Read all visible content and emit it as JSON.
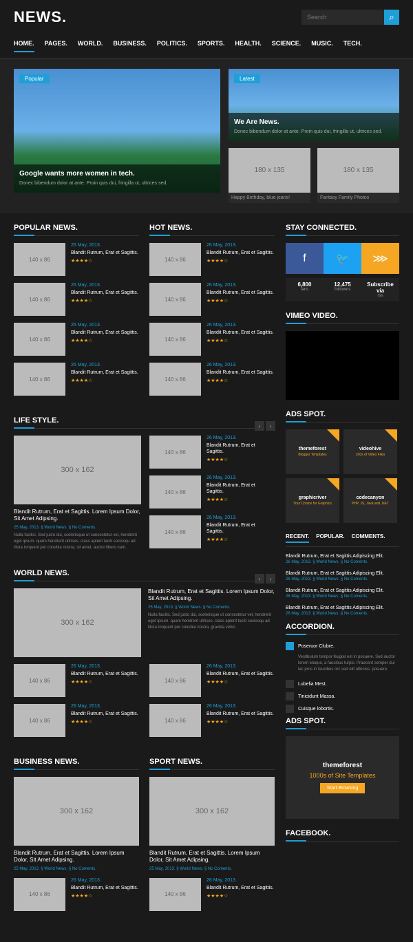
{
  "header": {
    "logo": "NEWS.",
    "search_placeholder": "Search"
  },
  "nav": {
    "items": [
      "HOME.",
      "PAGES.",
      "WORLD.",
      "BUSINESS.",
      "POLITICS.",
      "SPORTS.",
      "HEALTH.",
      "SCIENCE.",
      "MUSIC.",
      "TECH."
    ]
  },
  "hero": {
    "main": {
      "badge": "Popular",
      "title": "Google wants more women in tech.",
      "desc": "Donec bibendum dolor at ante. Proin quis dui, fringilla ut, ultrices sed."
    },
    "side": {
      "badge": "Latest",
      "title": "We Are News.",
      "desc": "Donec bibendum dolor at ante. Proin quis dui, fringilla ut, ultrices sed."
    },
    "items": [
      {
        "ph": "180 x 135",
        "label": "Happy Birthday, blue jeans!"
      },
      {
        "ph": "180 x 135",
        "label": "Fantasy Family Photos"
      }
    ]
  },
  "popular": {
    "title": "POPULAR NEWS.",
    "items": [
      {
        "ph": "140 x 86",
        "date": "26 May, 2013.",
        "title": "Blandit Rutrum, Erat et Sagittis.",
        "stars": "★★★★☆"
      },
      {
        "ph": "140 x 86",
        "date": "26 May, 2013.",
        "title": "Blandit Rutrum, Erat et Sagittis.",
        "stars": "★★★★☆"
      },
      {
        "ph": "140 x 86",
        "date": "26 May, 2013.",
        "title": "Blandit Rutrum, Erat et Sagittis.",
        "stars": "★★★★☆"
      },
      {
        "ph": "140 x 86",
        "date": "26 May, 2013.",
        "title": "Blandit Rutrum, Erat et Sagittis.",
        "stars": "★★★★☆"
      }
    ]
  },
  "hot": {
    "title": "HOT NEWS.",
    "items": [
      {
        "ph": "140 x 86",
        "date": "26 May, 2013.",
        "title": "Blandit Rutrum, Erat et Sagittis.",
        "stars": "★★★★☆"
      },
      {
        "ph": "140 x 86",
        "date": "26 May, 2013.",
        "title": "Blandit Rutrum, Erat et Sagittis.",
        "stars": "★★★★☆"
      },
      {
        "ph": "140 x 86",
        "date": "26 May, 2013.",
        "title": "Blandit Rutrum, Erat et Sagittis.",
        "stars": "★★★★☆"
      },
      {
        "ph": "140 x 86",
        "date": "26 May, 2013.",
        "title": "Blandit Rutrum, Erat et Sagittis.",
        "stars": "★★★★☆"
      }
    ]
  },
  "lifestyle": {
    "title": "LIFE STYLE.",
    "main": {
      "ph": "300 x 162",
      "title": "Blandit Rutrum, Erat et Sagittis. Lorem Ipsum Dolor, Sit Amet Adipsing.",
      "meta": "25 May, 2013. § World News. § No Coments.",
      "text": "Nulla facilisi. Sed justo dui, scelerisque ut consectetur vel, hendrerit eget ipsum. quam hendrerit ultrices. class aptent taciti sociosqu ad litora torquent per conubia nostra, sit amet, auctor libero nam."
    },
    "items": [
      {
        "ph": "140 x 86",
        "date": "26 May, 2013.",
        "title": "Blandit Rutrum, Erat et Sagittis.",
        "stars": "★★★★☆"
      },
      {
        "ph": "140 x 86",
        "date": "26 May, 2013.",
        "title": "Blandit Rutrum, Erat et Sagittis.",
        "stars": "★★★★☆"
      },
      {
        "ph": "140 x 86",
        "date": "26 May, 2013.",
        "title": "Blandit Rutrum, Erat et Sagittis.",
        "stars": "★★★★☆"
      }
    ]
  },
  "world": {
    "title": "WORLD NEWS.",
    "main": {
      "ph": "300 x 162",
      "title": "Blandit Rutrum, Erat et Sagittis. Lorem Ipsum Dolor, Sit Amet Adipsing.",
      "meta": "25 May, 2013. § World News. § No Coments.",
      "text": "Nulla facilisi. Sed justo dui, scelerisque ut consectetur vel, hendrerit eget ipsum. quam hendrerit ultrices. class aptent taciti sociosqu ad litora torquent per conubia nostra, gravida vehic."
    },
    "items": [
      {
        "ph": "140 x 86",
        "date": "26 May, 2013.",
        "title": "Blandit Rutrum, Erat et Sagittis.",
        "stars": "★★★★☆"
      },
      {
        "ph": "140 x 86",
        "date": "26 May, 2013.",
        "title": "Blandit Rutrum, Erat et Sagittis.",
        "stars": "★★★★☆"
      },
      {
        "ph": "140 x 86",
        "date": "26 May, 2013.",
        "title": "Blandit Rutrum, Erat et Sagittis.",
        "stars": "★★★★☆"
      },
      {
        "ph": "140 x 86",
        "date": "26 May, 2013.",
        "title": "Blandit Rutrum, Erat et Sagittis.",
        "stars": "★★★★☆"
      }
    ]
  },
  "business": {
    "title": "BUSINESS NEWS.",
    "main": {
      "ph": "300 x 162",
      "title": "Blandit Rutrum, Erat et Sagittis. Lorem Ipsum Dolor, Sit Amet Adipsing.",
      "meta": "25 May, 2013. § World News. § No Coments."
    },
    "items": [
      {
        "ph": "140 x 86",
        "date": "26 May, 2013.",
        "title": "Blandit Rutrum, Erat et Sagittis.",
        "stars": "★★★★☆"
      }
    ]
  },
  "sport": {
    "title": "SPORT NEWS.",
    "main": {
      "ph": "300 x 162",
      "title": "Blandit Rutrum, Erat et Sagittis. Lorem Ipsum Dolor, Sit Amet Adipsing.",
      "meta": "25 May, 2013. § World News. § No Coments."
    },
    "items": [
      {
        "ph": "140 x 86",
        "date": "26 May, 2013.",
        "title": "Blandit Rutrum, Erat et Sagittis.",
        "stars": "★★★★☆"
      }
    ]
  },
  "sidebar": {
    "connected": {
      "title": "STAY CONNECTED.",
      "stats": [
        {
          "num": "6,800",
          "label": "fans"
        },
        {
          "num": "12,475",
          "label": "followers"
        },
        {
          "num": "Subscribe via",
          "label": "rss"
        }
      ]
    },
    "vimeo": {
      "title": "VIMEO VIDEO."
    },
    "ads1": {
      "title": "ADS SPOT.",
      "boxes": [
        {
          "title": "themeforest",
          "sub": "Blogger Templates"
        },
        {
          "title": "videohive",
          "sub": "100s of Video Files"
        },
        {
          "title": "graphicriver",
          "sub": "Your Choice for Graphics"
        },
        {
          "title": "codecanyon",
          "sub": "PHP, JS, Java and .NET"
        }
      ]
    },
    "tabs": [
      "RECENT.",
      "POPULAR.",
      "COMMENTS."
    ],
    "recent": [
      {
        "title": "Blandit Rutrum, Erat et Sagittis Adipiscing Elit.",
        "meta": "26 May, 2013. § World News. § No Coments."
      },
      {
        "title": "Blandit Rutrum, Erat et Sagittis Adipiscing Elit.",
        "meta": "26 May, 2013. § World News. § No Coments."
      },
      {
        "title": "Blandit Rutrum, Erat et Sagittis Adipiscing Elit.",
        "meta": "26 May, 2013. § World News. § No Coments."
      },
      {
        "title": "Blandit Rutrum, Erat et Sagittis Adipiscing Elit.",
        "meta": "26 May, 2013. § World News. § No Coments."
      }
    ],
    "accordion": {
      "title": "ACCORDION.",
      "items": [
        {
          "label": "Poseruor Clubre.",
          "active": true,
          "text": "Vestibulum tempor feugiat est in posuere. Sed auctor lorem eleque, a faucibus turpis. Praesent semper dui lac pros in faucibus orc sed elit ultricies. posuere."
        },
        {
          "label": "Lubelia Mest."
        },
        {
          "label": "Tinicidunt Massa."
        },
        {
          "label": "Cuisque lobortis."
        }
      ]
    },
    "ads2": {
      "title": "ADS SPOT.",
      "banner": {
        "title": "themeforest",
        "sub": "1000s of Site Templates",
        "btn": "Start Browsing"
      }
    },
    "facebook": {
      "title": "FACEBOOK."
    }
  }
}
